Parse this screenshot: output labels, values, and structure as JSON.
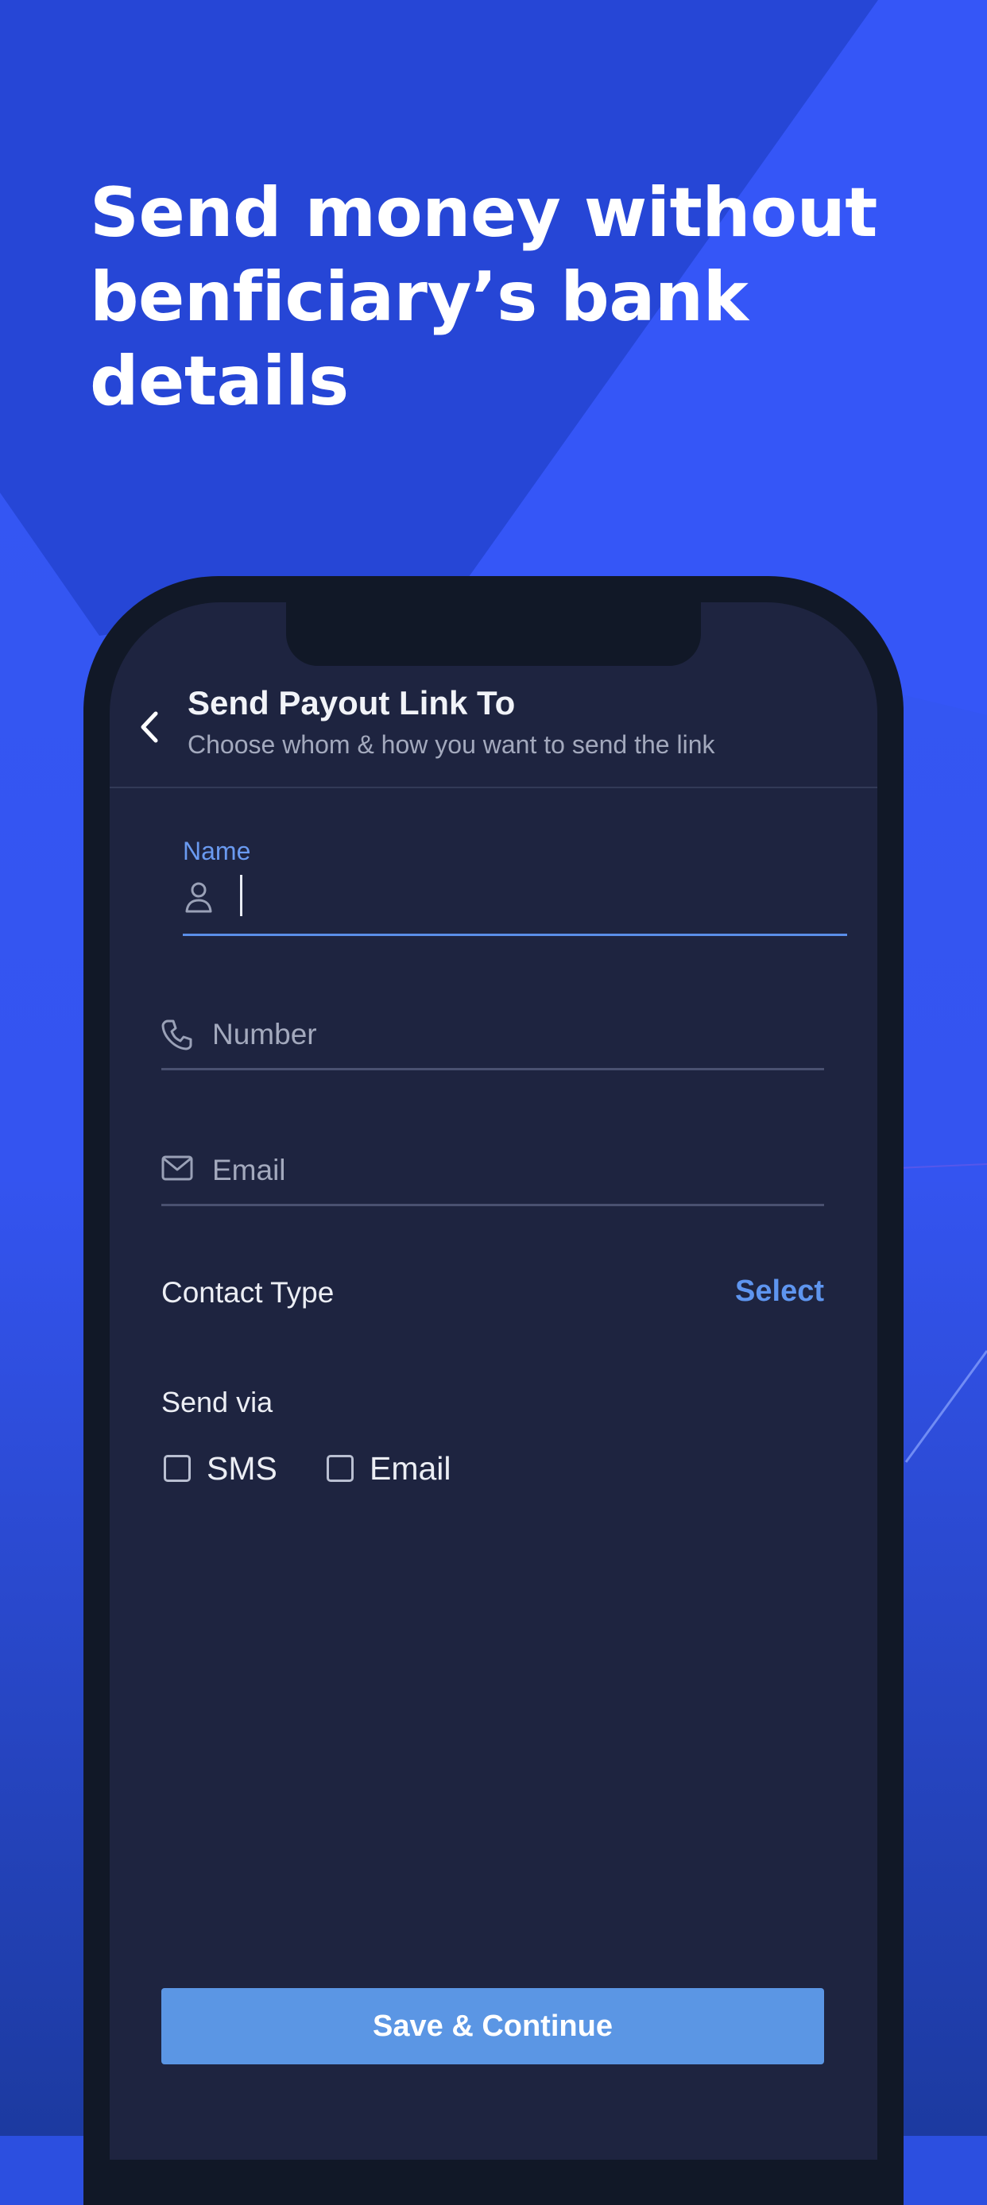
{
  "promo": {
    "headline": "Send money without benficiary’s bank details"
  },
  "colors": {
    "background_blue": "#2c4fe0",
    "phone_frame": "#111827",
    "screen_bg": "#1e2440",
    "accent": "#5b96e4",
    "link": "#5e95ef"
  },
  "app": {
    "header": {
      "back_icon": "chevron-left-icon",
      "title": "Send Payout Link To",
      "subtitle": "Choose whom & how you want to send the link"
    },
    "form": {
      "name": {
        "label": "Name",
        "value": "",
        "icon": "person-icon"
      },
      "number": {
        "placeholder": "Number",
        "icon": "phone-icon"
      },
      "email": {
        "placeholder": "Email",
        "icon": "mail-icon"
      },
      "contact_type": {
        "label": "Contact Type",
        "action": "Select"
      },
      "send_via": {
        "label": "Send via",
        "options": [
          {
            "label": "SMS",
            "checked": false
          },
          {
            "label": "Email",
            "checked": false
          }
        ]
      }
    },
    "save_button": "Save & Continue"
  }
}
